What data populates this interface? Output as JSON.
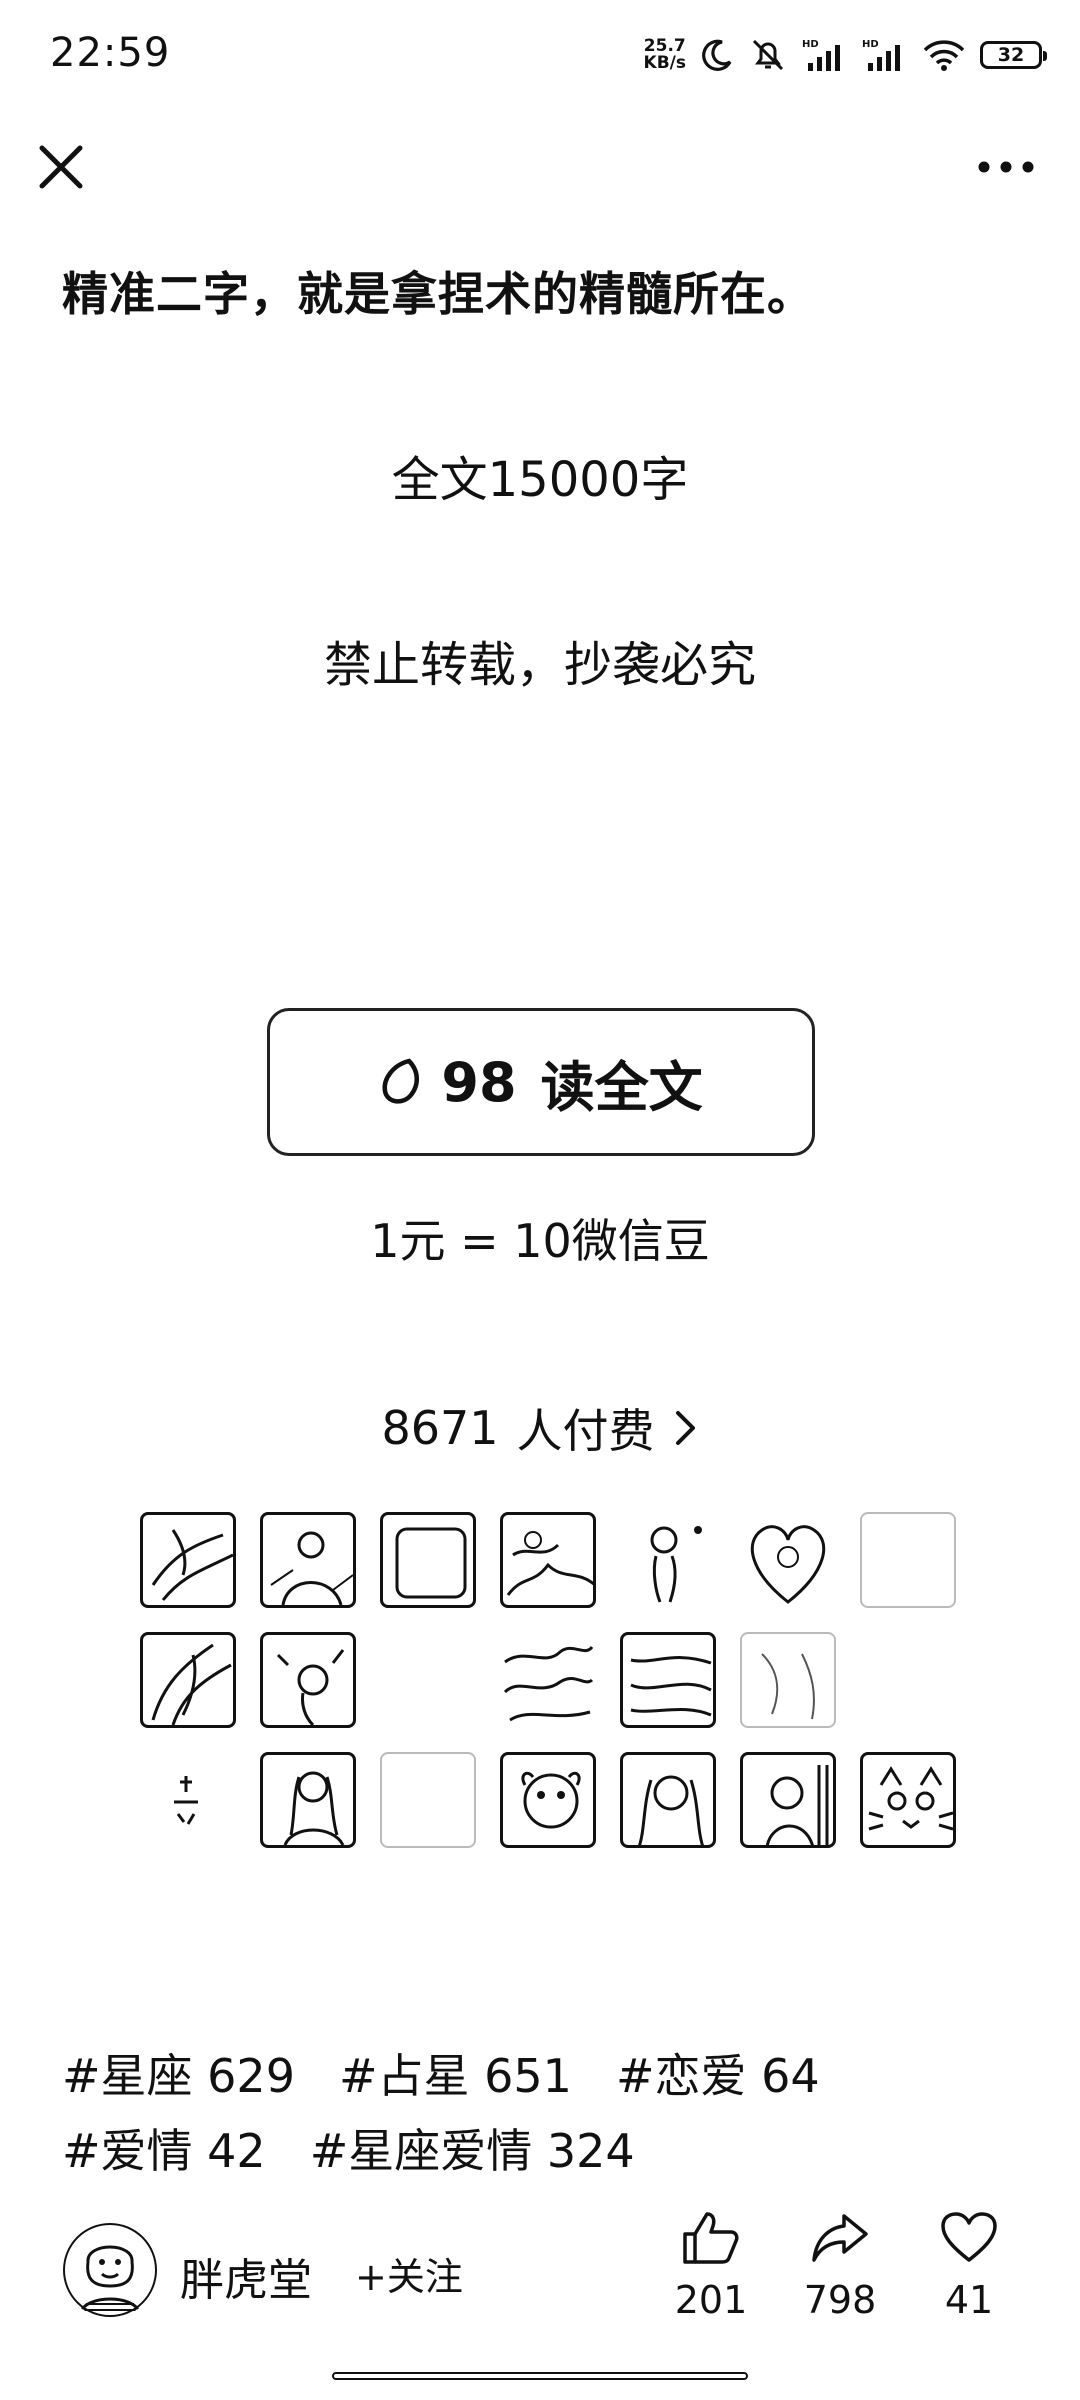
{
  "status_bar": {
    "time": "22:59",
    "net_speed_value": "25.7",
    "net_speed_unit": "KB/s",
    "signal_label": "HD",
    "battery": "32",
    "icons": [
      "moon-icon",
      "mute-icon",
      "signal-icon",
      "wifi-icon",
      "battery-icon"
    ]
  },
  "nav": {
    "close_icon": "close-icon",
    "more_icon": "more-dots-icon"
  },
  "article": {
    "last_line": "精准二字，就是拿捏术的精髓所在。",
    "word_count": "全文15000字",
    "copyright": "禁止转载，抄袭必究"
  },
  "paywall": {
    "price": "98",
    "read_label": "读全文",
    "exchange_rate": "1元 = 10微信豆",
    "payers_count": "8671",
    "payers_label": "人付费",
    "coin_icon": "wechat-bean-icon"
  },
  "payer_avatars": [
    "avatar",
    "avatar",
    "avatar",
    "avatar",
    "avatar",
    "avatar",
    "avatar",
    "avatar",
    "avatar",
    "avatar",
    "avatar",
    "avatar",
    "avatar",
    "avatar",
    "avatar",
    "avatar",
    "avatar",
    "avatar",
    "avatar",
    "avatar"
  ],
  "tags": [
    {
      "label": "#星座 629"
    },
    {
      "label": "#占星 651"
    },
    {
      "label": "#恋爱 64"
    },
    {
      "label": "#爱情 42"
    },
    {
      "label": "#星座爱情 324"
    }
  ],
  "author": {
    "name": "胖虎堂",
    "follow_label": "+关注"
  },
  "actions": {
    "like_count": "201",
    "share_count": "798",
    "favorite_count": "41"
  }
}
